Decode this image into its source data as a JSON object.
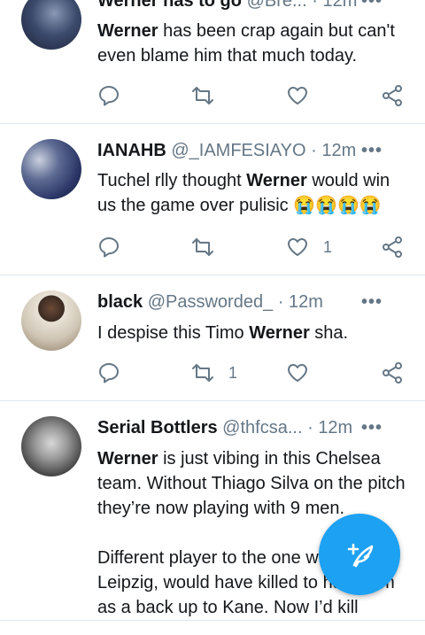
{
  "tweets": [
    {
      "name": "Werner has to go",
      "handle": "@Bre...",
      "time": "12m",
      "text_parts": [
        "",
        "Werner",
        " has been crap again but can't even blame him that much today."
      ],
      "retweets": "",
      "likes": ""
    },
    {
      "name": "IANAHB",
      "handle": "@_IAMFESIAYO",
      "time": "12m",
      "text_parts": [
        "Tuchel rlly thought ",
        "Werner",
        " would win us the game over pulisic 😭😭😭😭"
      ],
      "retweets": "",
      "likes": "1"
    },
    {
      "name": "black",
      "handle": "@Passworded_",
      "time": "12m",
      "text_parts": [
        "I despise this Timo ",
        "Werner",
        " sha."
      ],
      "retweets": "1",
      "likes": ""
    },
    {
      "name": "Serial Bottlers",
      "handle": "@thfcsa...",
      "time": "12m",
      "text_parts": [
        "",
        "Werner",
        " is just vibing in this Chelsea team. Without Thiago Silva on the pitch they’re now playing with 9 men.\n\nDifferent player to the one who was at Leipzig, would have killed to have him as a back up to Kane. Now I’d kill"
      ],
      "retweets": "",
      "likes": ""
    }
  ],
  "separator": "·",
  "more": "•••",
  "colors": {
    "accent": "#1da1f2",
    "muted": "#657786",
    "divider": "#e1e8ed"
  }
}
